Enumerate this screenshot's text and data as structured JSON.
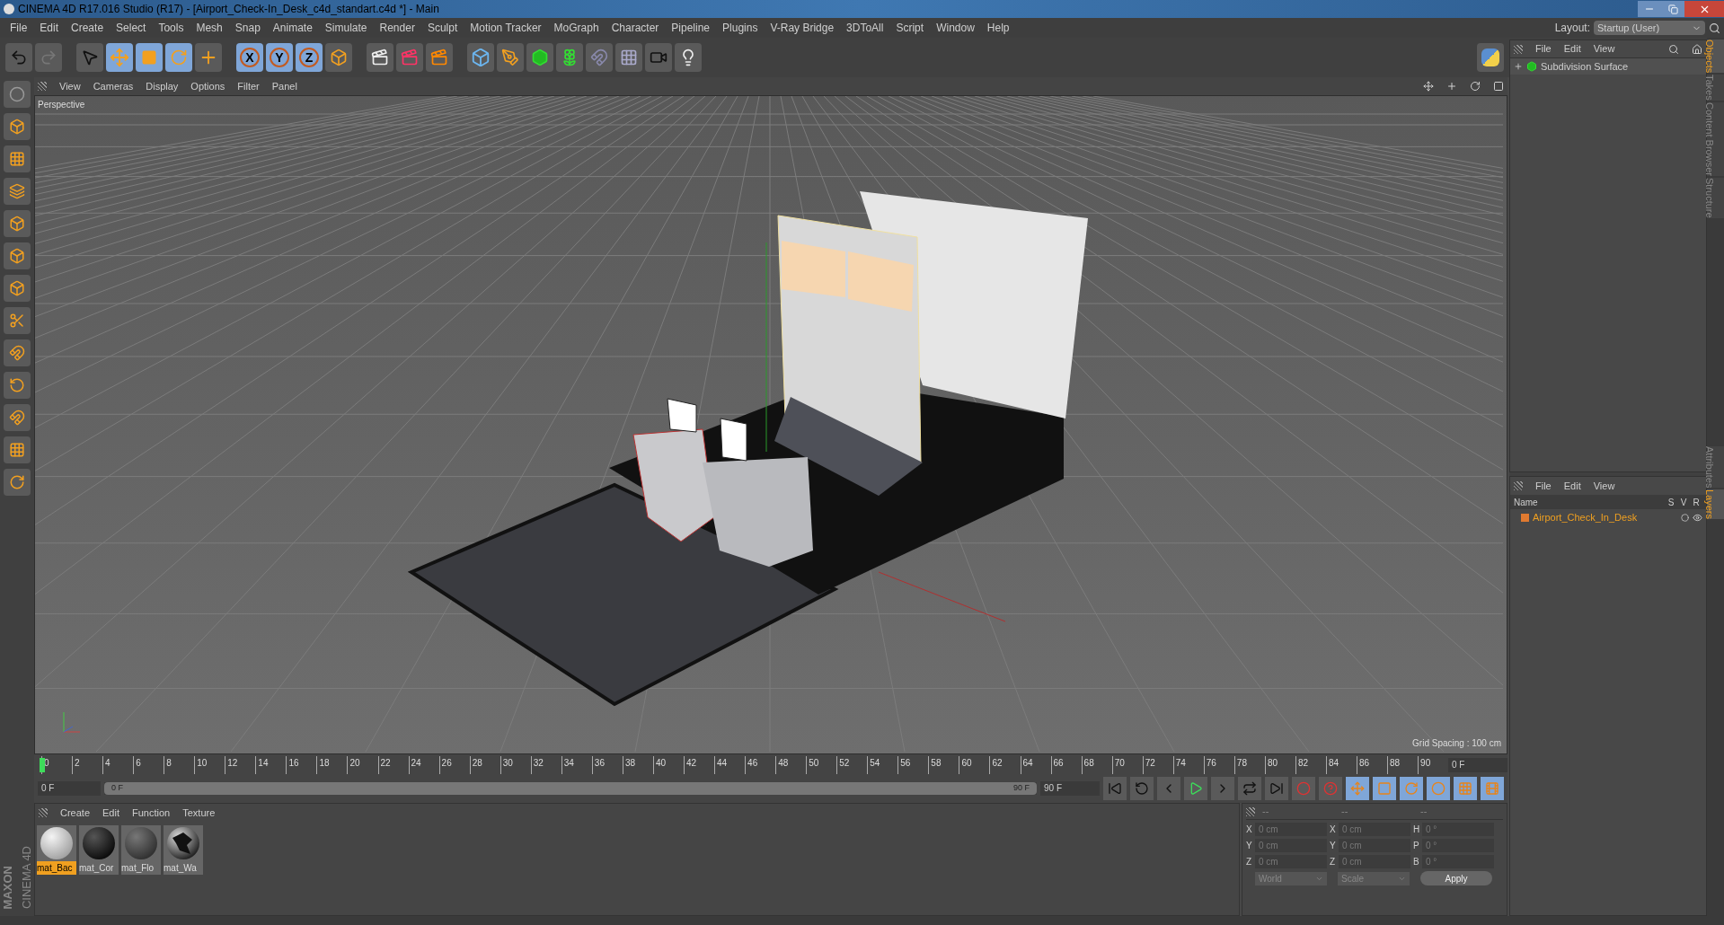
{
  "window": {
    "title": "CINEMA 4D R17.016 Studio (R17) - [Airport_Check-In_Desk_c4d_standart.c4d *] - Main"
  },
  "menu": [
    "File",
    "Edit",
    "Create",
    "Select",
    "Tools",
    "Mesh",
    "Snap",
    "Animate",
    "Simulate",
    "Render",
    "Sculpt",
    "Motion Tracker",
    "MoGraph",
    "Character",
    "Pipeline",
    "Plugins",
    "V-Ray Bridge",
    "3DToAll",
    "Script",
    "Window",
    "Help"
  ],
  "layout": {
    "label": "Layout:",
    "value": "Startup (User)"
  },
  "axis_buttons": [
    {
      "label": "X",
      "on": true
    },
    {
      "label": "Y",
      "on": true
    },
    {
      "label": "Z",
      "on": true
    }
  ],
  "viewport": {
    "menu": [
      "View",
      "Cameras",
      "Display",
      "Options",
      "Filter",
      "Panel"
    ],
    "camera": "Perspective",
    "grid_spacing": "Grid Spacing : 100 cm"
  },
  "timeline": {
    "ticks": [
      "0",
      "2",
      "4",
      "6",
      "8",
      "10",
      "12",
      "14",
      "16",
      "18",
      "20",
      "22",
      "24",
      "26",
      "28",
      "30",
      "32",
      "34",
      "36",
      "38",
      "40",
      "42",
      "44",
      "46",
      "48",
      "50",
      "52",
      "54",
      "56",
      "58",
      "60",
      "62",
      "64",
      "66",
      "68",
      "70",
      "72",
      "74",
      "76",
      "78",
      "80",
      "82",
      "84",
      "86",
      "88",
      "90"
    ],
    "current": "0 F",
    "start": "0 F",
    "range": {
      "start": "0 F",
      "end": "90 F",
      "level": 1
    },
    "end": "90 F"
  },
  "materials": {
    "menu": [
      "Create",
      "Edit",
      "Function",
      "Texture"
    ],
    "items": [
      {
        "name": "mat_Bac",
        "kind": "white",
        "selected": true
      },
      {
        "name": "mat_Cor",
        "kind": "black",
        "selected": false
      },
      {
        "name": "mat_Flo",
        "kind": "dark",
        "selected": false
      },
      {
        "name": "mat_Wa",
        "kind": "patterned",
        "selected": false
      }
    ]
  },
  "coordinates": {
    "headers": [
      "--",
      "--",
      "--"
    ],
    "rows": [
      {
        "cells": [
          {
            "axis": "X",
            "value": "0 cm"
          },
          {
            "axis": "X",
            "value": "0 cm"
          },
          {
            "axis": "H",
            "value": "0 °"
          }
        ]
      },
      {
        "cells": [
          {
            "axis": "Y",
            "value": "0 cm"
          },
          {
            "axis": "Y",
            "value": "0 cm"
          },
          {
            "axis": "P",
            "value": "0 °"
          }
        ]
      },
      {
        "cells": [
          {
            "axis": "Z",
            "value": "0 cm"
          },
          {
            "axis": "Z",
            "value": "0 cm"
          },
          {
            "axis": "B",
            "value": "0 °"
          }
        ]
      }
    ],
    "mode": "World",
    "type": "Scale",
    "apply": "Apply"
  },
  "objects": {
    "menu": [
      "File",
      "Edit",
      "View"
    ],
    "items": [
      {
        "name": "Subdivision Surface"
      }
    ]
  },
  "layers": {
    "menu": [
      "File",
      "Edit",
      "View"
    ],
    "columns": [
      "Name",
      "S",
      "V",
      "R"
    ],
    "items": [
      {
        "name": "Airport_Check_In_Desk",
        "color": "#e07a30"
      }
    ]
  },
  "side_tabs_top": [
    {
      "label": "Objects",
      "selected": true
    },
    {
      "label": "Takes",
      "selected": false
    },
    {
      "label": "Content Browser",
      "selected": false
    },
    {
      "label": "Structure",
      "selected": false
    }
  ],
  "side_tabs_bottom": [
    {
      "label": "Attributes",
      "selected": false
    },
    {
      "label": "Layers",
      "selected": true
    }
  ],
  "branding": {
    "maker": "MAXON",
    "product": "CINEMA 4D"
  }
}
